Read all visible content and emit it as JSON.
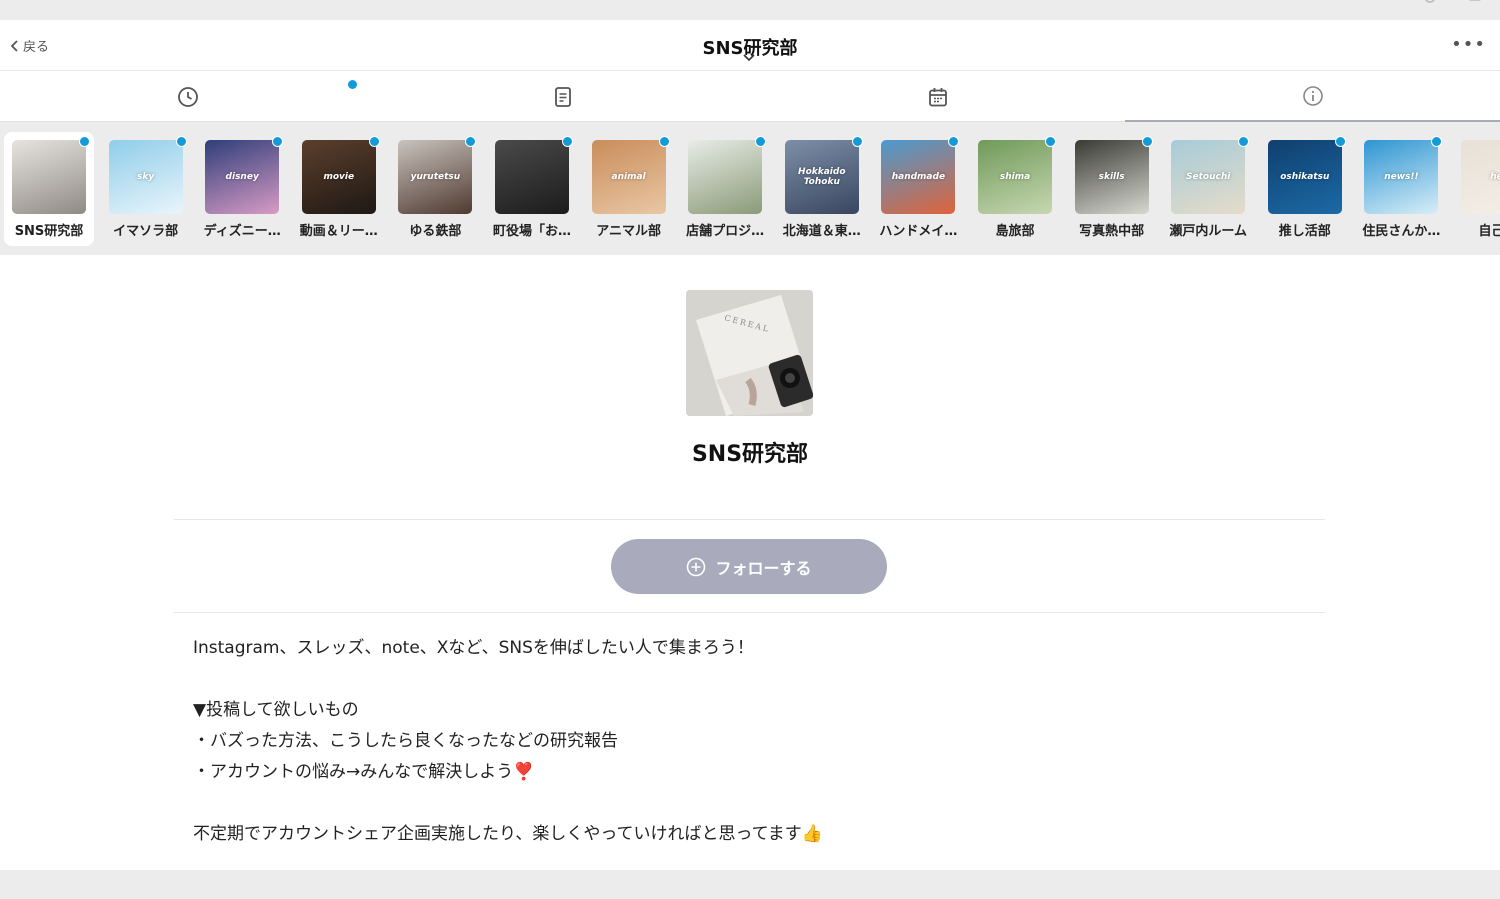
{
  "header": {
    "back_label": "戻る",
    "title": "SNS研究部",
    "more_label": "•••"
  },
  "tabs": [
    {
      "icon": "clock-icon"
    },
    {
      "icon": "document-icon"
    },
    {
      "icon": "calendar-icon"
    },
    {
      "icon": "info-icon",
      "active": true
    }
  ],
  "channels": [
    {
      "name": "SNS研究部",
      "thumb_label": "",
      "colors": [
        "#e7e4df",
        "#8f8a84"
      ],
      "selected": true
    },
    {
      "name": "イマソラ部",
      "thumb_label": "sky",
      "colors": [
        "#8fcde9",
        "#e9f5fb"
      ]
    },
    {
      "name": "ディズニー…",
      "thumb_label": "disney",
      "colors": [
        "#2f3e7a",
        "#d79bc4"
      ]
    },
    {
      "name": "動画＆リー…",
      "thumb_label": "movie",
      "colors": [
        "#5c3f2c",
        "#1e1814"
      ]
    },
    {
      "name": "ゆる鉄部",
      "thumb_label": "yurutetsu",
      "colors": [
        "#c9c3bd",
        "#4f3a31"
      ]
    },
    {
      "name": "町役場「お…",
      "thumb_label": "",
      "colors": [
        "#4a4a4a",
        "#1c1c1c"
      ]
    },
    {
      "name": "アニマル部",
      "thumb_label": "animal",
      "colors": [
        "#c98d5b",
        "#e9c7a4"
      ]
    },
    {
      "name": "店舗プロジ…",
      "thumb_label": "",
      "colors": [
        "#e8ece6",
        "#8a9a78"
      ]
    },
    {
      "name": "北海道＆東…",
      "thumb_label": "Hokkaido\nTohoku",
      "colors": [
        "#7d8fa8",
        "#3a4660"
      ]
    },
    {
      "name": "ハンドメイ…",
      "thumb_label": "handmade",
      "colors": [
        "#4a9bd0",
        "#e0633a"
      ]
    },
    {
      "name": "島旅部",
      "thumb_label": "shima",
      "colors": [
        "#6f9a5a",
        "#c7d7b0"
      ]
    },
    {
      "name": "写真熱中部",
      "thumb_label": "skills",
      "colors": [
        "#3a3a34",
        "#d7d8d0"
      ]
    },
    {
      "name": "瀬戸内ルーム",
      "thumb_label": "Setouchi",
      "colors": [
        "#a7cbd8",
        "#e5dcc9"
      ]
    },
    {
      "name": "推し活部",
      "thumb_label": "oshikatsu",
      "colors": [
        "#0f3f6e",
        "#1c6aa6"
      ]
    },
    {
      "name": "住民さんか…",
      "thumb_label": "news!!",
      "colors": [
        "#2d95d2",
        "#d8eef7"
      ]
    },
    {
      "name": "自己紹",
      "thumb_label": "hel",
      "colors": [
        "#e8e0d6",
        "#f4efe8"
      ]
    }
  ],
  "group": {
    "name": "SNS研究部",
    "follow_label": "フォローする",
    "description": [
      "Instagram、スレッズ、note、Xなど、SNSを伸ばしたい人で集まろう！",
      "",
      "▼投稿して欲しいもの",
      "・バズった方法、こうしたら良くなったなどの研究報告",
      "・アカウントの悩み→みんなで解決しよう❣️",
      "",
      "不定期でアカウントシェア企画実施したり、楽しくやっていければと思ってます👍"
    ]
  },
  "colors": {
    "accent_dot": "#139bd8",
    "follow_button": "#a9abbd",
    "active_tab_underline": "#a8aab8"
  }
}
